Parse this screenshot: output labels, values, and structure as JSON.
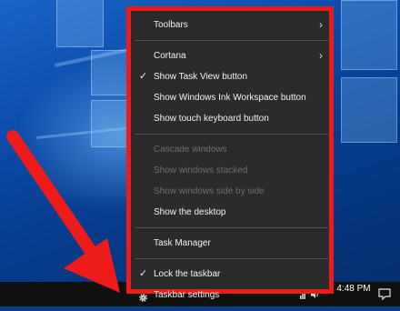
{
  "menu": {
    "items": [
      {
        "label": "Toolbars",
        "submenu": true
      },
      {
        "label": "Cortana",
        "submenu": true
      },
      {
        "label": "Show Task View button",
        "checked": true
      },
      {
        "label": "Show Windows Ink Workspace button"
      },
      {
        "label": "Show touch keyboard button"
      },
      {
        "label": "Cascade windows",
        "disabled": true
      },
      {
        "label": "Show windows stacked",
        "disabled": true
      },
      {
        "label": "Show windows side by side",
        "disabled": true
      },
      {
        "label": "Show the desktop"
      },
      {
        "label": "Task Manager"
      },
      {
        "label": "Lock the taskbar",
        "checked": true
      },
      {
        "label": "Taskbar settings",
        "icon": "gear-icon"
      }
    ]
  },
  "taskbar": {
    "time": "4:48 PM",
    "date": "",
    "icons": [
      "network-icon",
      "volume-icon",
      "action-center-icon"
    ]
  },
  "colors": {
    "menu_bg": "#2b2b2b",
    "highlight": "#ee1b1b",
    "taskbar_bg": "#101010"
  }
}
